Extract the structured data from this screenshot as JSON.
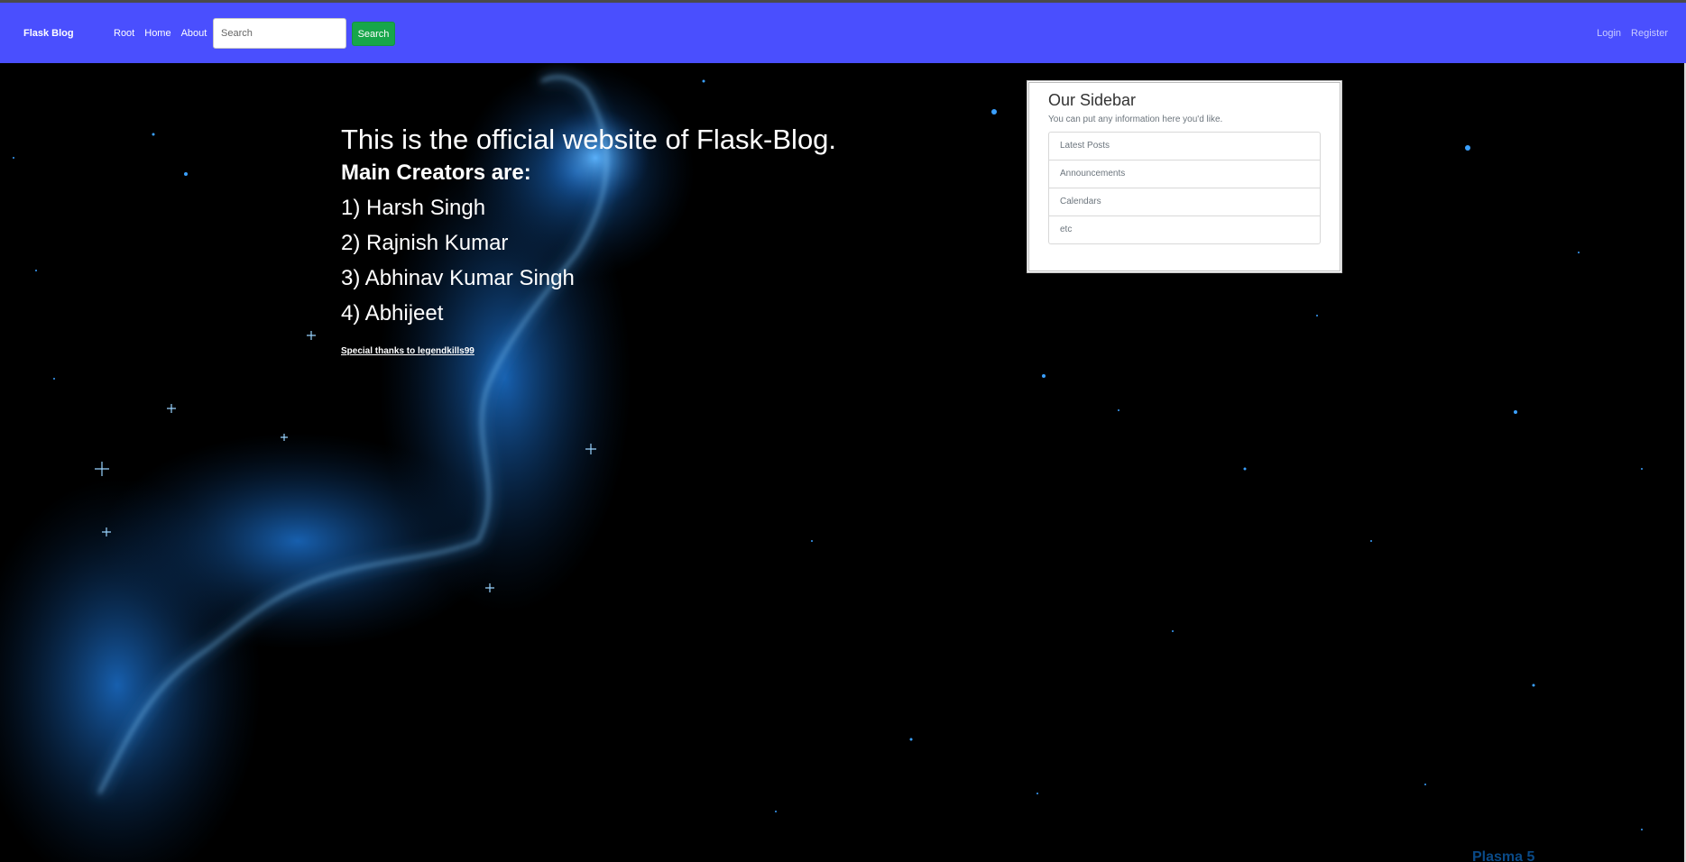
{
  "navbar": {
    "brand": "Flask Blog",
    "links": [
      "Root",
      "Home",
      "About"
    ],
    "search_placeholder": "Search",
    "search_button": "Search",
    "auth_links": [
      "Login",
      "Register"
    ],
    "color": "#4a4ffe"
  },
  "main": {
    "headline": "This is the official website of Flask-Blog.",
    "subhead": "Main Creators are:",
    "creators": [
      "1) Harsh Singh",
      "2) Rajnish Kumar",
      "3) Abhinav Kumar Singh",
      "4) Abhijeet"
    ],
    "thanks": "Special thanks to legendkills99"
  },
  "sidebar": {
    "title": "Our Sidebar",
    "description": "You can put any information here you'd like.",
    "items": [
      "Latest Posts",
      "Announcements",
      "Calendars",
      "etc"
    ]
  },
  "wallpaper": {
    "watermark": "Plasma 5",
    "accent": "#2a8ff5"
  }
}
